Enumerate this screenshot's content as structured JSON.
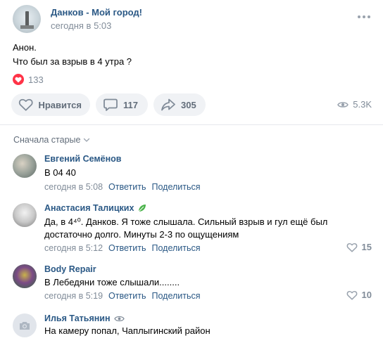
{
  "post": {
    "group_name": "Данков - Мой город!",
    "time": "сегодня в 5:03",
    "text_lines": [
      "Анон.",
      "Что был за взрыв в 4 утра ?"
    ],
    "reactions_count": "133",
    "like_label": "Нравится",
    "comments_count": "117",
    "shares_count": "305",
    "views_count": "5.3K"
  },
  "comments_section": {
    "sort_label": "Сначала старые",
    "reply_label": "Ответить",
    "share_label": "Поделиться",
    "comments": [
      {
        "author": "Евгений Семёнов",
        "text_lines": [
          "В 04 40"
        ],
        "time": "сегодня в 5:08",
        "likes": ""
      },
      {
        "author": "Анастасия Талицких",
        "text_lines": [
          "Да, в 4⁴⁰. Данков. Я тоже слышала. Сильный взрыв и гул ещё был",
          "достаточно долго. Минуты 2-3 по ощущениям"
        ],
        "time": "сегодня в 5:12",
        "likes": "15"
      },
      {
        "author": "Body Repair",
        "text_lines": [
          "В Лебедяни тоже слышали........"
        ],
        "time": "сегодня в 5:19",
        "likes": "10"
      },
      {
        "author": "Илья Татьянин",
        "text_lines": [
          "На камеру попал, Чаплыгинский район"
        ],
        "time": "",
        "likes": ""
      }
    ]
  },
  "colors": {
    "link": "#2a5885",
    "secondary": "#818c99",
    "button_bg": "#f0f2f5",
    "heart": "#ff3347"
  },
  "icons": [
    "more-icon",
    "heart-icon",
    "comment-icon",
    "share-icon",
    "eye-icon",
    "chevron-down-icon",
    "leaf-icon",
    "camera-icon"
  ]
}
